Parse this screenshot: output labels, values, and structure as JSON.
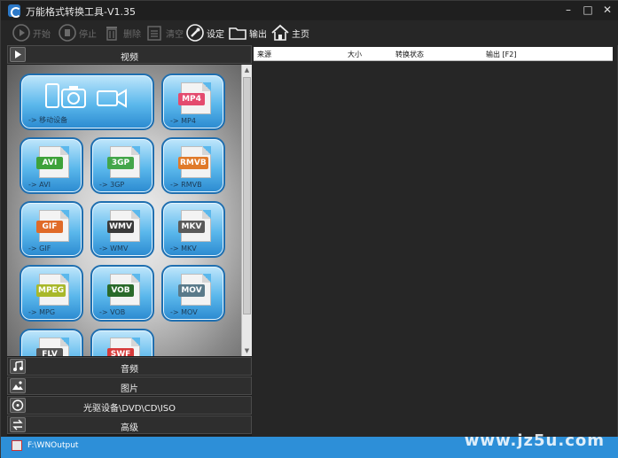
{
  "window": {
    "title": "万能格式转换工具-V1.35"
  },
  "toolbar": {
    "start": "开始",
    "stop": "停止",
    "delete": "删除",
    "clear": "清空",
    "settings": "设定",
    "output": "输出",
    "home": "主页"
  },
  "sections": {
    "video": "视频",
    "audio": "音频",
    "image": "图片",
    "disc": "光驱设备\\DVD\\CD\\ISO",
    "advanced": "高级"
  },
  "tiles": [
    {
      "label": "-> 移动设备"
    },
    {
      "label": "-> MP4",
      "badge": "MP4",
      "color": "#e44b6e"
    },
    {
      "label": "-> AVI",
      "badge": "AVI",
      "color": "#3ea23a"
    },
    {
      "label": "-> 3GP",
      "badge": "3GP",
      "color": "#43a64a"
    },
    {
      "label": "-> RMVB",
      "badge": "RMVB",
      "color": "#e07a2a"
    },
    {
      "label": "-> GIF",
      "badge": "GIF",
      "color": "#e06a28"
    },
    {
      "label": "-> WMV",
      "badge": "WMV",
      "color": "#3a3a3a"
    },
    {
      "label": "-> MKV",
      "badge": "MKV",
      "color": "#5a5a5a"
    },
    {
      "label": "-> MPG",
      "badge": "MPEG",
      "color": "#a8b82a"
    },
    {
      "label": "-> VOB",
      "badge": "VOB",
      "color": "#2a6a2a"
    },
    {
      "label": "-> MOV",
      "badge": "MOV",
      "color": "#5a7a8a"
    },
    {
      "label": "",
      "badge": "FLV",
      "color": "#555555"
    },
    {
      "label": "",
      "badge": "SWF",
      "color": "#d63a3a"
    }
  ],
  "table": {
    "columns": [
      "来源",
      "大小",
      "转换状态",
      "输出 [F2]"
    ]
  },
  "status": {
    "output_path": "F:\\WNOutput"
  },
  "watermark": "www.jz5u.com"
}
